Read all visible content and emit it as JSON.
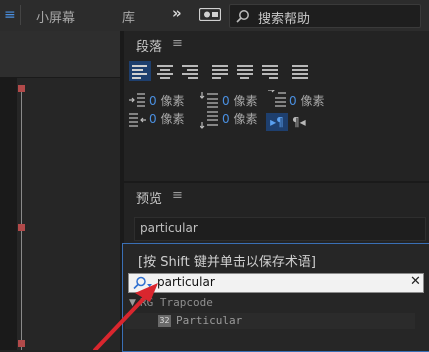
{
  "topbar": {
    "menu_icon": "hamburger-icon",
    "workspace_small": "小屏幕",
    "workspace_library": "库",
    "more_glyph": "»",
    "camera_icon": "camera-icon",
    "search_placeholder": "搜索帮助"
  },
  "paragraph": {
    "title": "段落",
    "menu_glyph": "≡",
    "alignments": [
      "align-left",
      "align-center",
      "align-right",
      "justify-last-left",
      "justify-last-center",
      "justify-last-right",
      "justify-all"
    ],
    "rows": [
      {
        "value": "0",
        "unit": "像素"
      },
      {
        "value": "0",
        "unit": "像素"
      },
      {
        "value": "0",
        "unit": "像素"
      },
      {
        "value": "0",
        "unit": "像素"
      },
      {
        "value": "0",
        "unit": "像素"
      }
    ],
    "dir_ltr": "▸¶",
    "dir_rtl": "¶◂"
  },
  "preview": {
    "title": "预览",
    "menu_glyph": "≡",
    "field_value": "particular"
  },
  "effects": {
    "hint": "[按 Shift 键并单击以保存术语]",
    "search_value": "particular",
    "clear_glyph": "✕",
    "category": "RG Trapcode",
    "item_badge": "32",
    "item": "Particular"
  },
  "colors": {
    "accent": "#4a90e2",
    "annotation": "#d9262e",
    "keyframe": "#b24a4a"
  }
}
